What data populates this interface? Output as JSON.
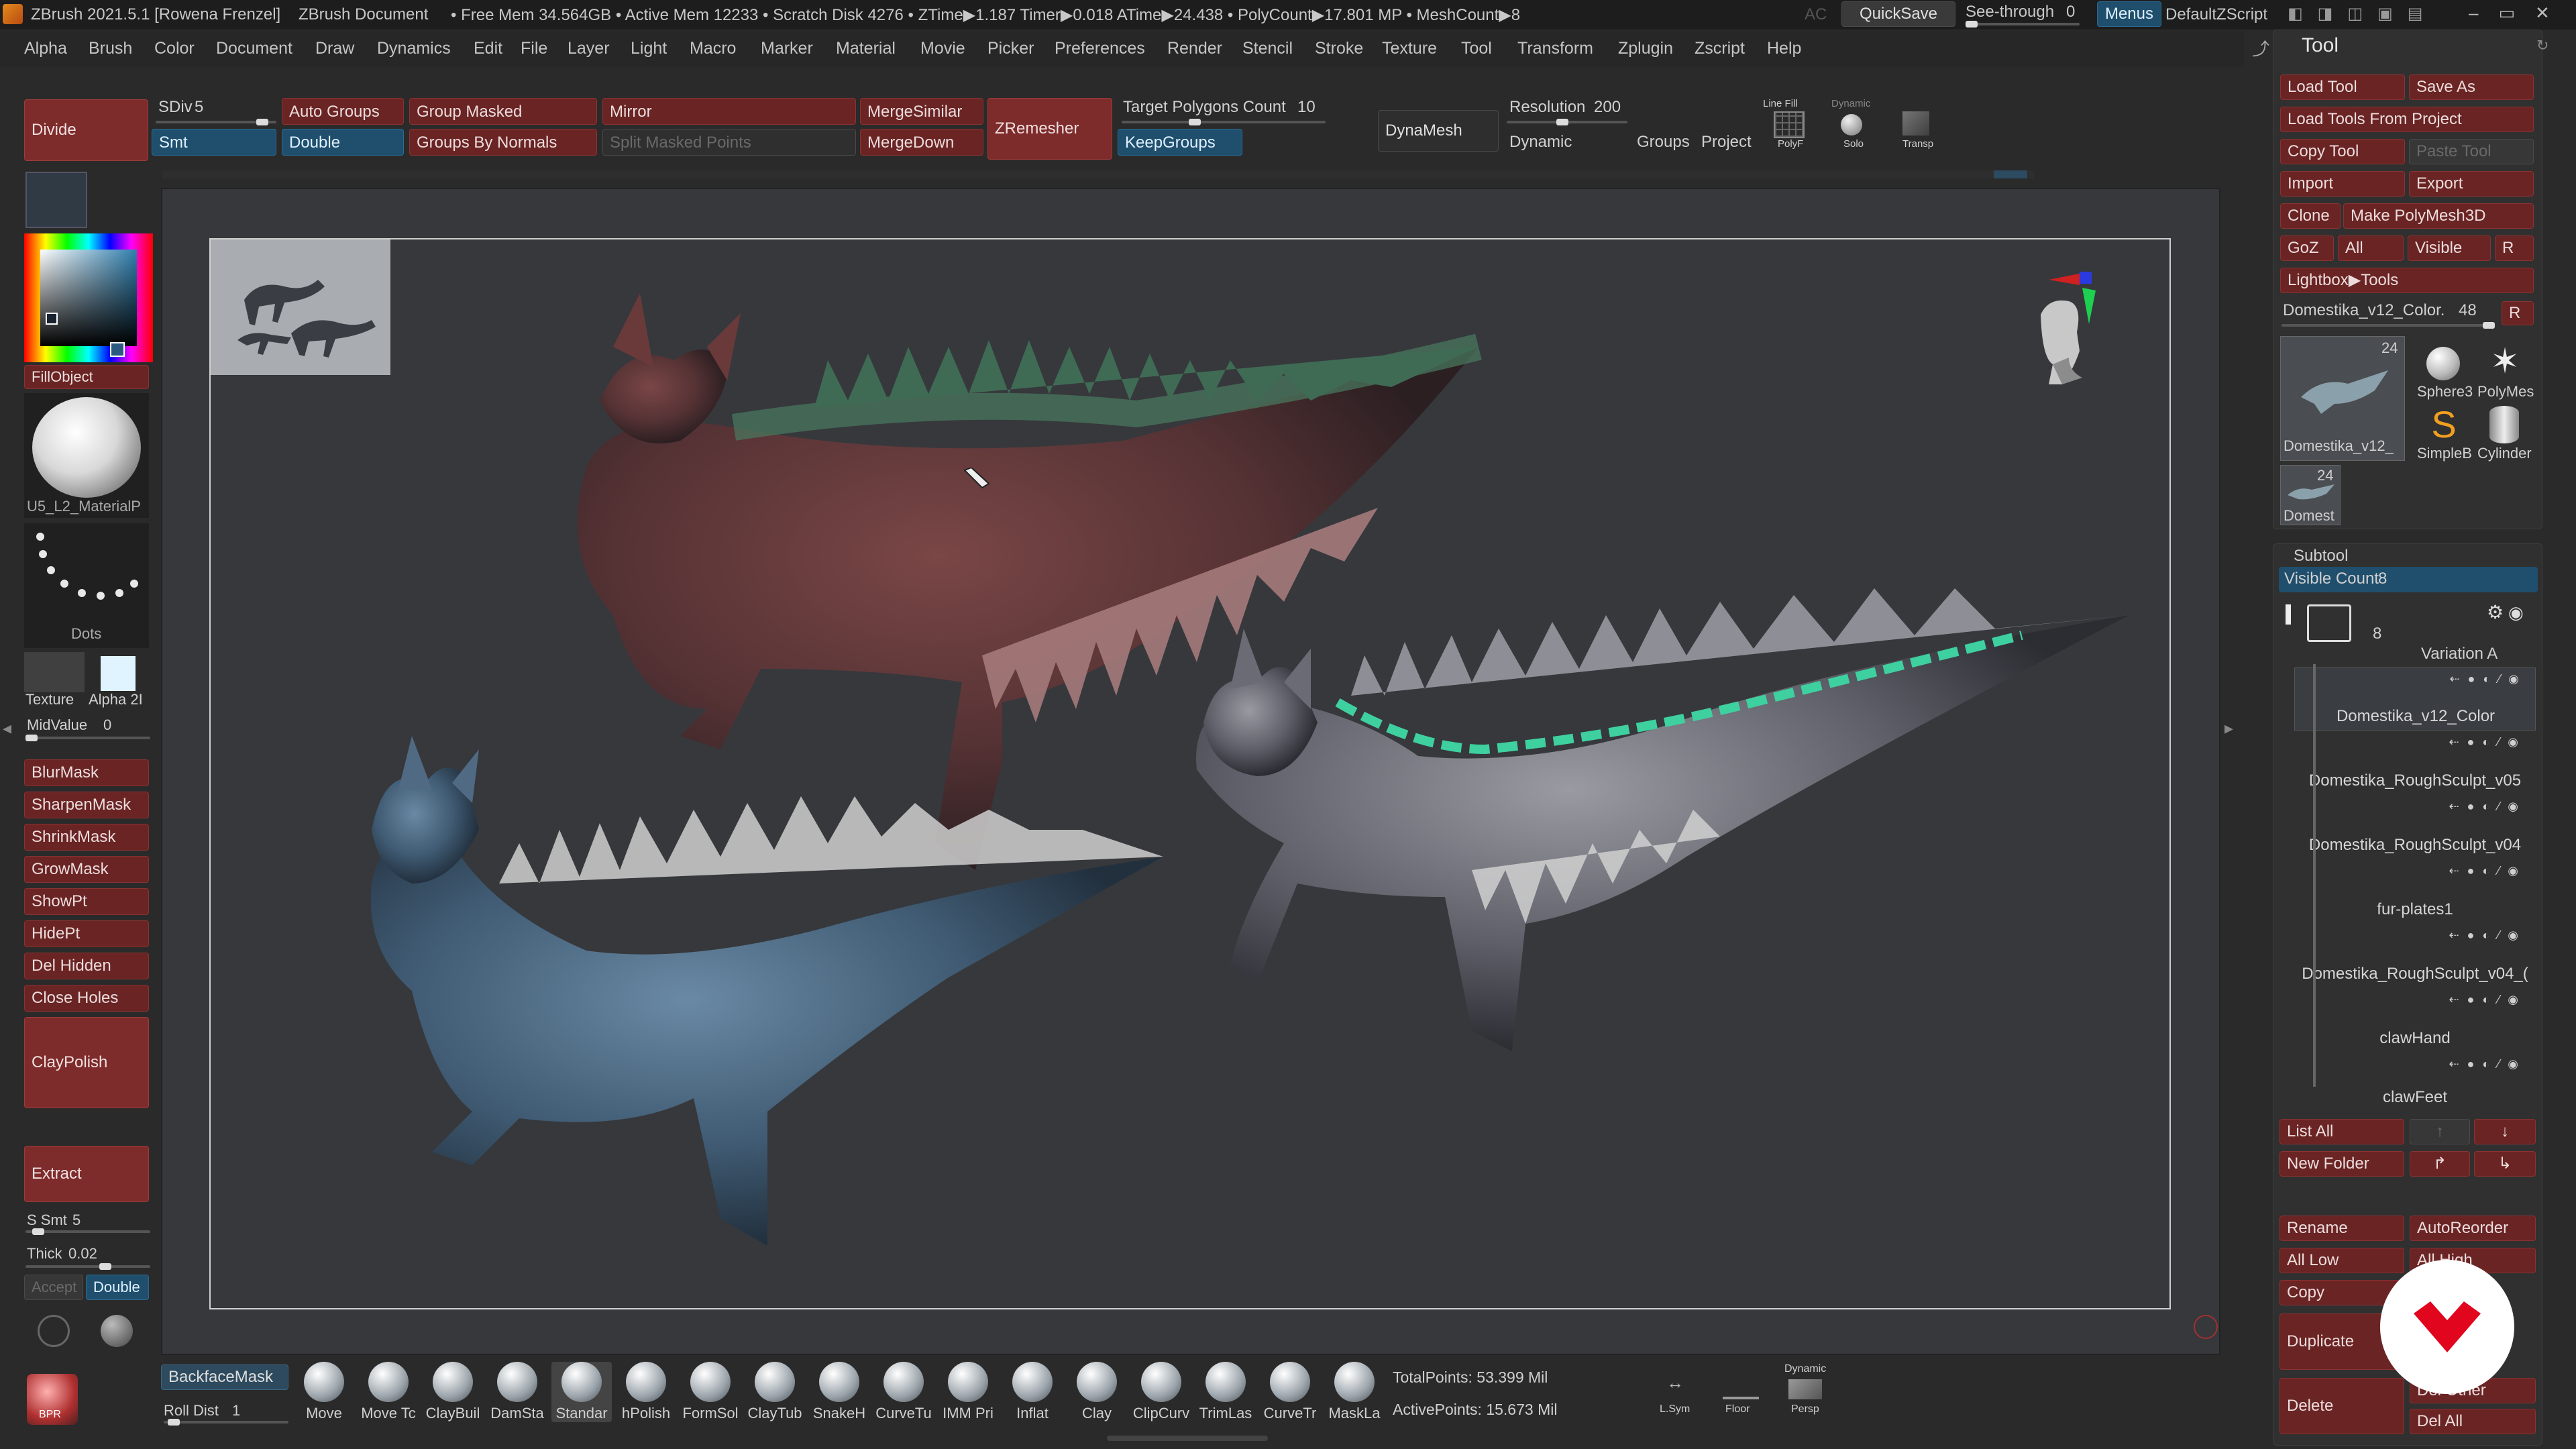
{
  "title_bar": {
    "app": "ZBrush 2021.5.1 [Rowena Frenzel]",
    "document": "ZBrush Document",
    "stats": "• Free Mem 34.564GB • Active Mem 12233 • Scratch Disk 4276 • ZTime▶1.187 Timer▶0.018 ATime▶24.438 • PolyCount▶17.801 MP • MeshCount▶8",
    "ac": "AC",
    "quicksave": "QuickSave",
    "see_through_label": "See-through",
    "see_through_value": "0",
    "menus": "Menus",
    "default_zscript": "DefaultZScript"
  },
  "menu": [
    "Alpha",
    "Brush",
    "Color",
    "Document",
    "Draw",
    "Dynamics",
    "Edit",
    "File",
    "Layer",
    "Light",
    "Macro",
    "Marker",
    "Material",
    "Movie",
    "Picker",
    "Preferences",
    "Render",
    "Stencil",
    "Stroke",
    "Texture",
    "Tool",
    "Transform",
    "Zplugin",
    "Zscript",
    "Help"
  ],
  "top_shelf": {
    "divide": "Divide",
    "sdiv_label": "SDiv",
    "sdiv_value": "5",
    "smt": "Smt",
    "auto_groups": "Auto Groups",
    "double": "Double",
    "group_masked": "Group Masked",
    "groups_by_normals": "Groups By Normals",
    "mirror": "Mirror",
    "split_masked_points": "Split Masked Points",
    "merge_similar": "MergeSimilar",
    "merge_down": "MergeDown",
    "zremesher": "ZRemesher",
    "target_polygons_label": "Target Polygons Count",
    "target_polygons_value": "10",
    "keep_groups": "KeepGroups",
    "dynamesh": "DynaMesh",
    "resolution_label": "Resolution",
    "resolution_value": "200",
    "dynamic": "Dynamic",
    "groups": "Groups",
    "project": "Project",
    "line_fill": "Line Fill",
    "polyf": "PolyF",
    "dynamic_small": "Dynamic",
    "solo": "Solo",
    "transp": "Transp"
  },
  "left_shelf": {
    "fill_object": "FillObject",
    "material_name": "U5_L2_MaterialP",
    "stroke_name": "Dots",
    "texture_label": "Texture",
    "alpha_label": "Alpha 2I",
    "midvalue_label": "MidValue",
    "midvalue_value": "0",
    "mask_buttons": [
      "BlurMask",
      "SharpenMask",
      "ShrinkMask",
      "GrowMask",
      "ShowPt",
      "HidePt",
      "Del Hidden",
      "Close Holes"
    ],
    "clay_polish": "ClayPolish",
    "extract": "Extract",
    "s_smt_label": "S Smt",
    "s_smt_value": "5",
    "thick_label": "Thick",
    "thick_value": "0.02",
    "accept": "Accept",
    "double": "Double",
    "bpr": "BPR"
  },
  "bottom_shelf": {
    "backface_mask": "BackfaceMask",
    "roll_dist_label": "Roll Dist",
    "roll_dist_value": "1",
    "brushes": [
      "Move",
      "Move Tc",
      "ClayBuil",
      "DamSta",
      "Standar",
      "hPolish",
      "FormSol",
      "ClayTub",
      "SnakeH",
      "CurveTu",
      "IMM Pri",
      "Inflat",
      "Clay",
      "ClipCurv",
      "TrimLas",
      "CurveTr",
      "MaskLa"
    ],
    "total_points": "TotalPoints: 53.399 Mil",
    "active_points": "ActivePoints: 15.673 Mil",
    "lsym": "L.Sym",
    "floor": "Floor",
    "dynamic_persp_top": "Dynamic",
    "persp": "Persp"
  },
  "tool_panel": {
    "title": "Tool",
    "buttons": {
      "load_tool": "Load Tool",
      "save_as": "Save As",
      "load_tools_from_project": "Load Tools From Project",
      "copy_tool": "Copy Tool",
      "paste_tool": "Paste Tool",
      "import": "Import",
      "export": "Export",
      "clone": "Clone",
      "make_polymesh3d": "Make PolyMesh3D",
      "goz": "GoZ",
      "all": "All",
      "visible": "Visible",
      "r": "R",
      "lightbox_tools": "Lightbox▶Tools"
    },
    "current_tool_label": "Domestika_v12_Color.",
    "current_tool_value": "48",
    "current_tool_r": "R",
    "thumbs": [
      {
        "name": "Domestika_v12_",
        "count": "24"
      },
      {
        "name": "Sphere3",
        "count": ""
      },
      {
        "name": "PolyMes",
        "count": ""
      },
      {
        "name": "SimpleB",
        "count": ""
      },
      {
        "name": "Cylinder",
        "count": ""
      },
      {
        "name": "Domest",
        "count": "24"
      }
    ]
  },
  "subtool_panel": {
    "title": "Subtool",
    "visible_count_label": "Visible Count",
    "visible_count_value": "8",
    "folder_count": "8",
    "folder_name": "Variation A",
    "items": [
      "Domestika_v12_Color",
      "Domestika_RoughSculpt_v05",
      "Domestika_RoughSculpt_v04",
      "fur-plates1",
      "Domestika_RoughSculpt_v04_(",
      "clawHand",
      "clawFeet"
    ],
    "list_all": "List All",
    "new_folder": "New Folder",
    "rename": "Rename",
    "auto_reorder": "AutoReorder",
    "all_low": "All Low",
    "all_high": "All High",
    "copy": "Copy",
    "duplicate": "Duplicate",
    "delete": "Delete",
    "del_other": "Del Other",
    "del_all": "Del All"
  },
  "colors": {
    "accent_red": "#7e2b2b",
    "accent_blue": "#1f4f6d",
    "viewport_bg": "#36383c",
    "background": "#2a2a2a"
  }
}
